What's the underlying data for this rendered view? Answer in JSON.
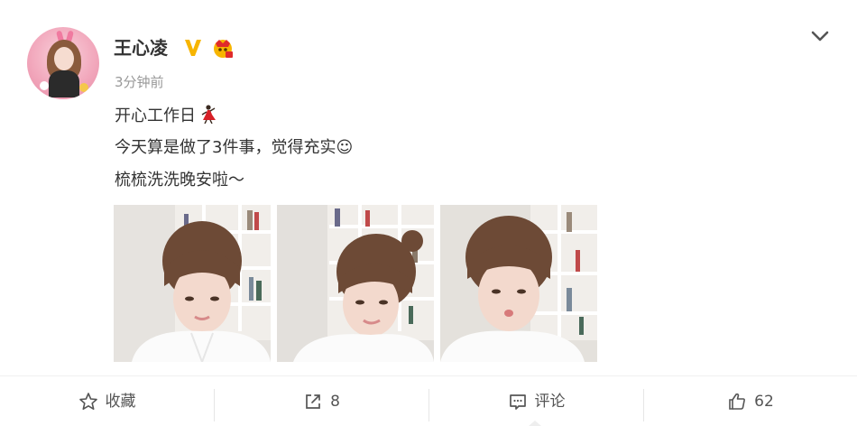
{
  "post": {
    "author": "王心凌",
    "time": "3分钟前",
    "lines": [
      "开心工作日",
      "今天算是做了3件事，觉得充实☺",
      "梳梳洗洗晚安啦～"
    ],
    "photos": [
      {
        "alt": "photo-1"
      },
      {
        "alt": "photo-2"
      },
      {
        "alt": "photo-3"
      }
    ]
  },
  "actions": {
    "favorite_label": "收藏",
    "share_count": "8",
    "comment_label": "评论",
    "like_count": "62"
  },
  "colors": {
    "text": "#333333",
    "muted": "#999999",
    "verified": "#f7b500",
    "icon": "#555555"
  },
  "icons": {
    "verified": "verified-v-icon",
    "vip": "vip-crown-icon",
    "menu": "chevron-down-icon",
    "dance": "dancer-emoji-icon",
    "favorite": "star-outline-icon",
    "share": "share-out-icon",
    "comment": "comment-icon",
    "like": "thumb-up-icon"
  }
}
